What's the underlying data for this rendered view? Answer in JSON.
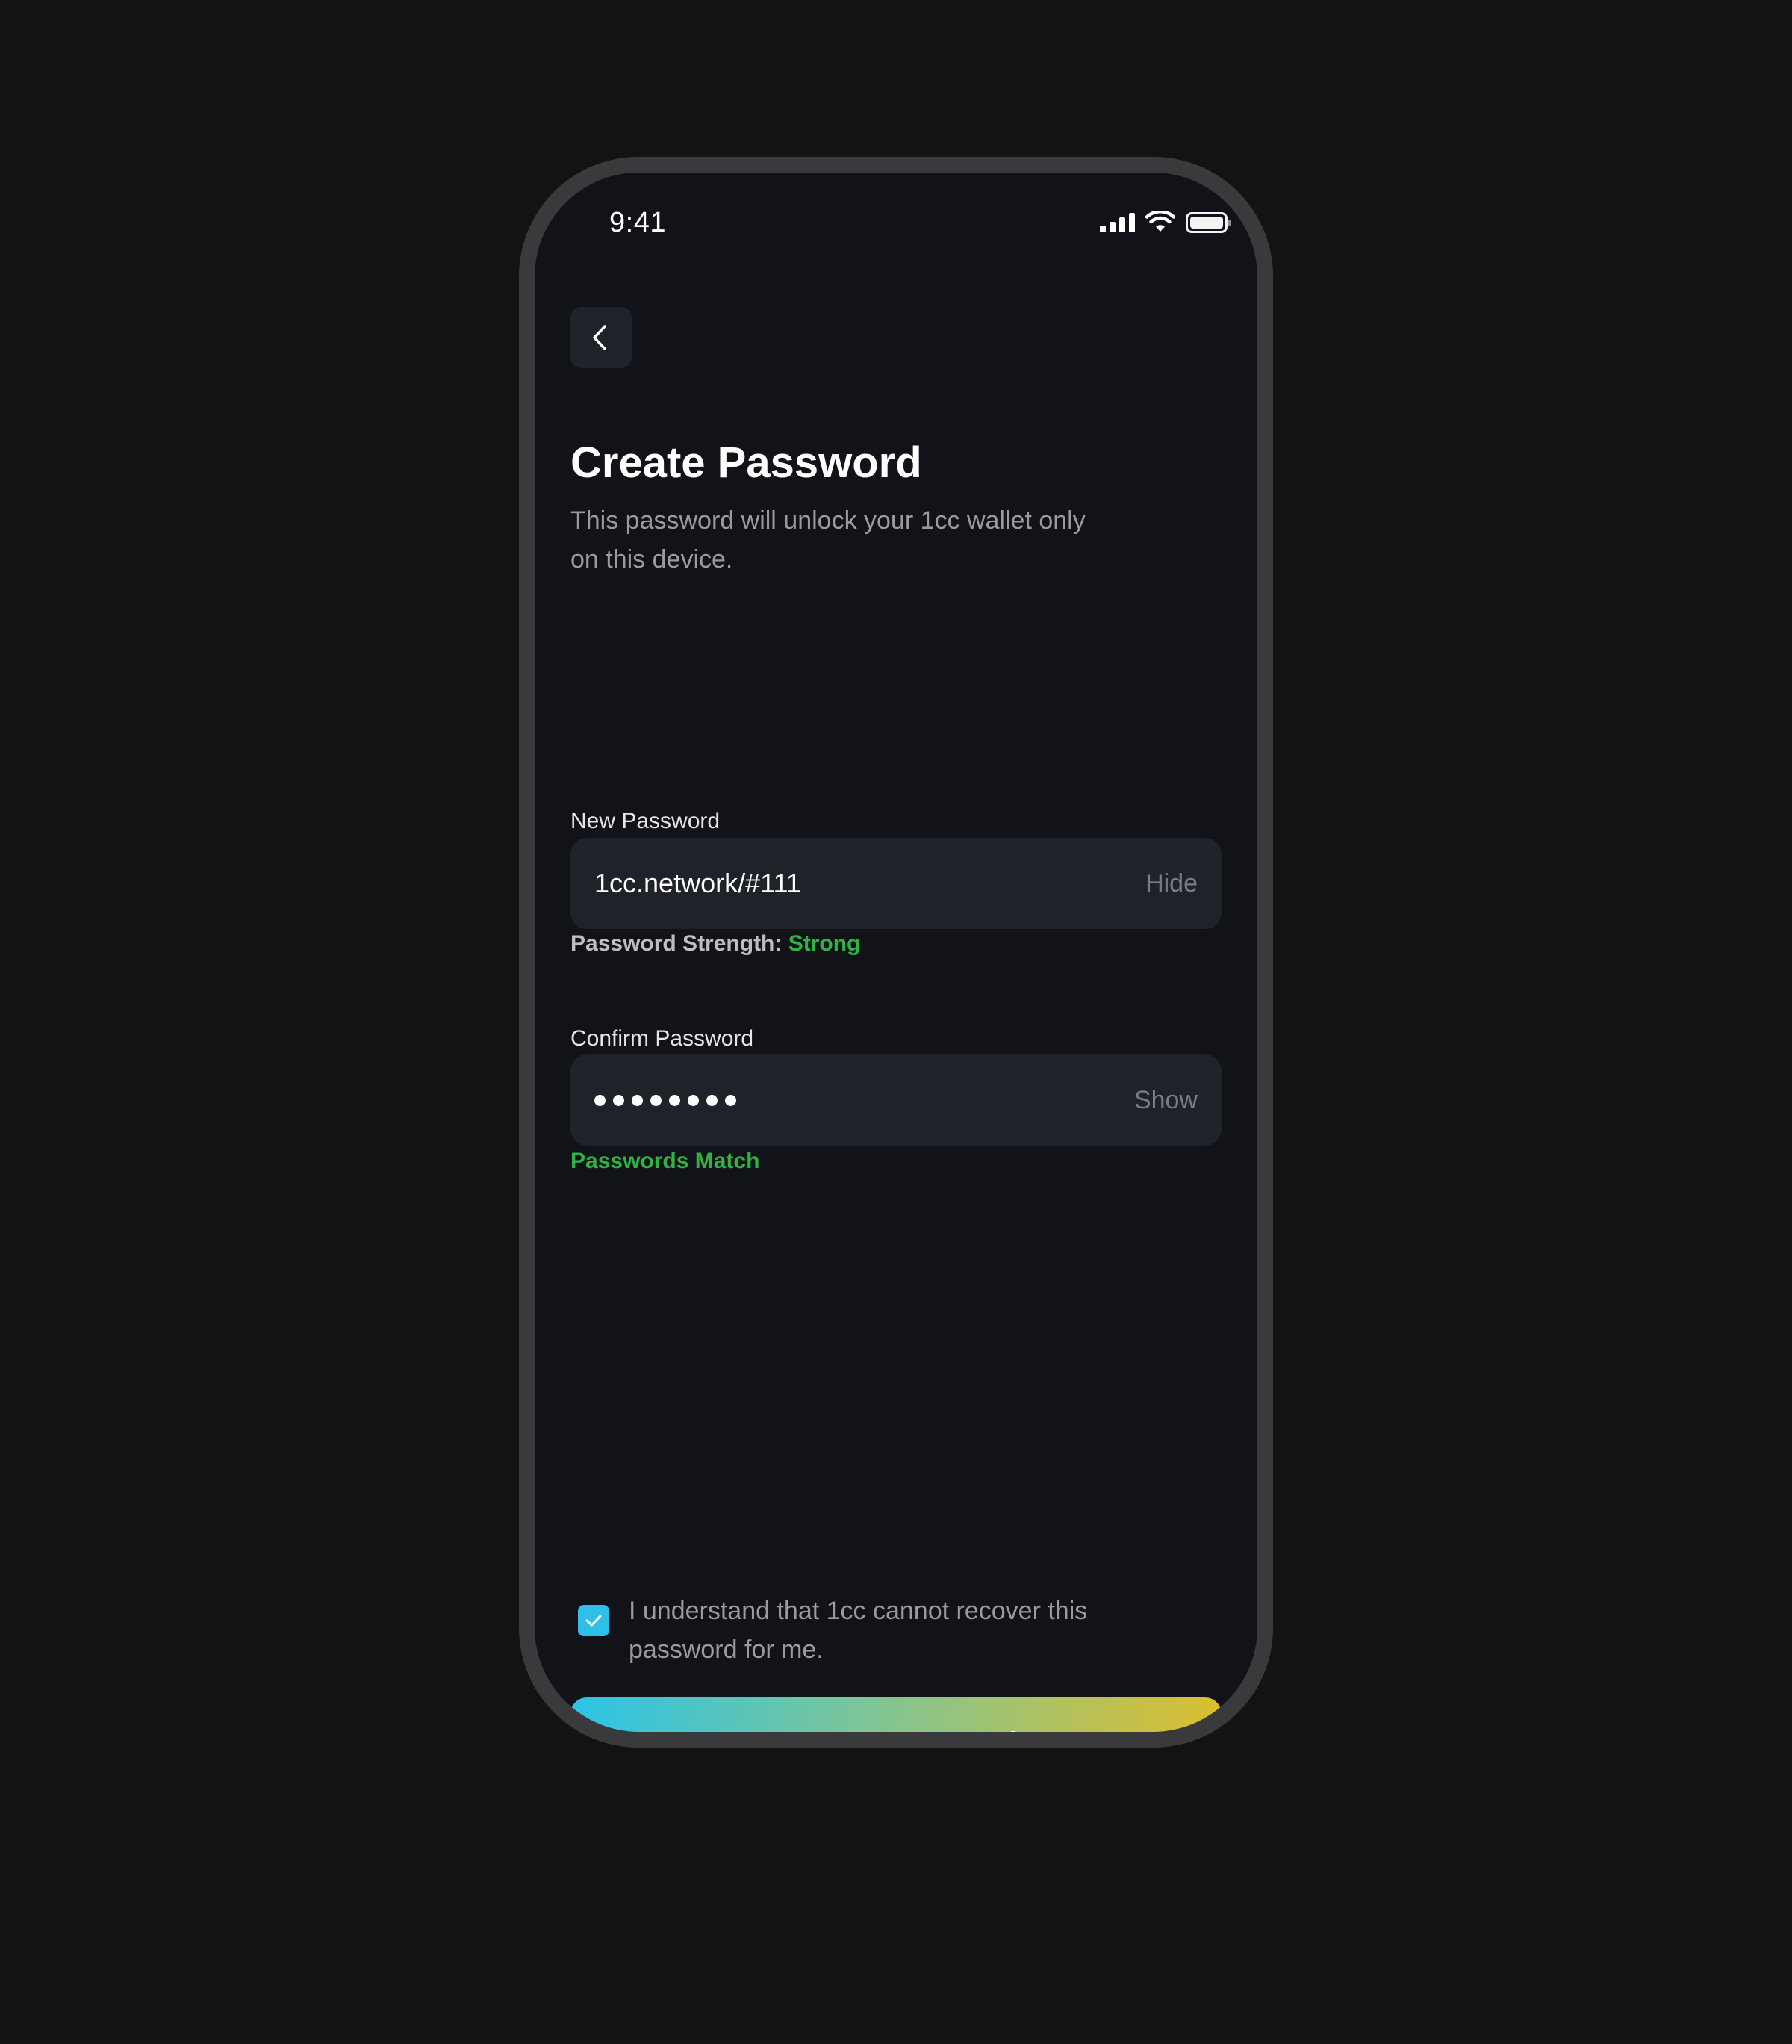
{
  "status_bar": {
    "time": "9:41"
  },
  "header": {
    "title": "Create Password",
    "subtitle": "This password will unlock your 1cc wallet only on this device."
  },
  "new_password": {
    "label": "New Password",
    "value": "1cc.network/#111",
    "toggle_label": "Hide",
    "strength_label": "Password Strength:",
    "strength_value": "Strong"
  },
  "confirm_password": {
    "label": "Confirm Password",
    "masked_dot_count": 8,
    "toggle_label": "Show",
    "match_text": "Passwords Match"
  },
  "agreement": {
    "checked": true,
    "text": "I understand that 1cc cannot recover this password for me."
  },
  "primary_button": {
    "label": "Create Password"
  },
  "icons": {
    "back": "chevron-left-icon",
    "signal": "cellular-signal-icon",
    "wifi": "wifi-icon",
    "battery": "battery-icon",
    "check": "checkmark-icon"
  },
  "colors": {
    "background": "#131313",
    "screen": "#121318",
    "input_bg": "#1f2229",
    "success": "#2fb344",
    "checkbox": "#2ec0e8",
    "gradient_start": "#2ac4e8",
    "gradient_end": "#e0be2b"
  }
}
